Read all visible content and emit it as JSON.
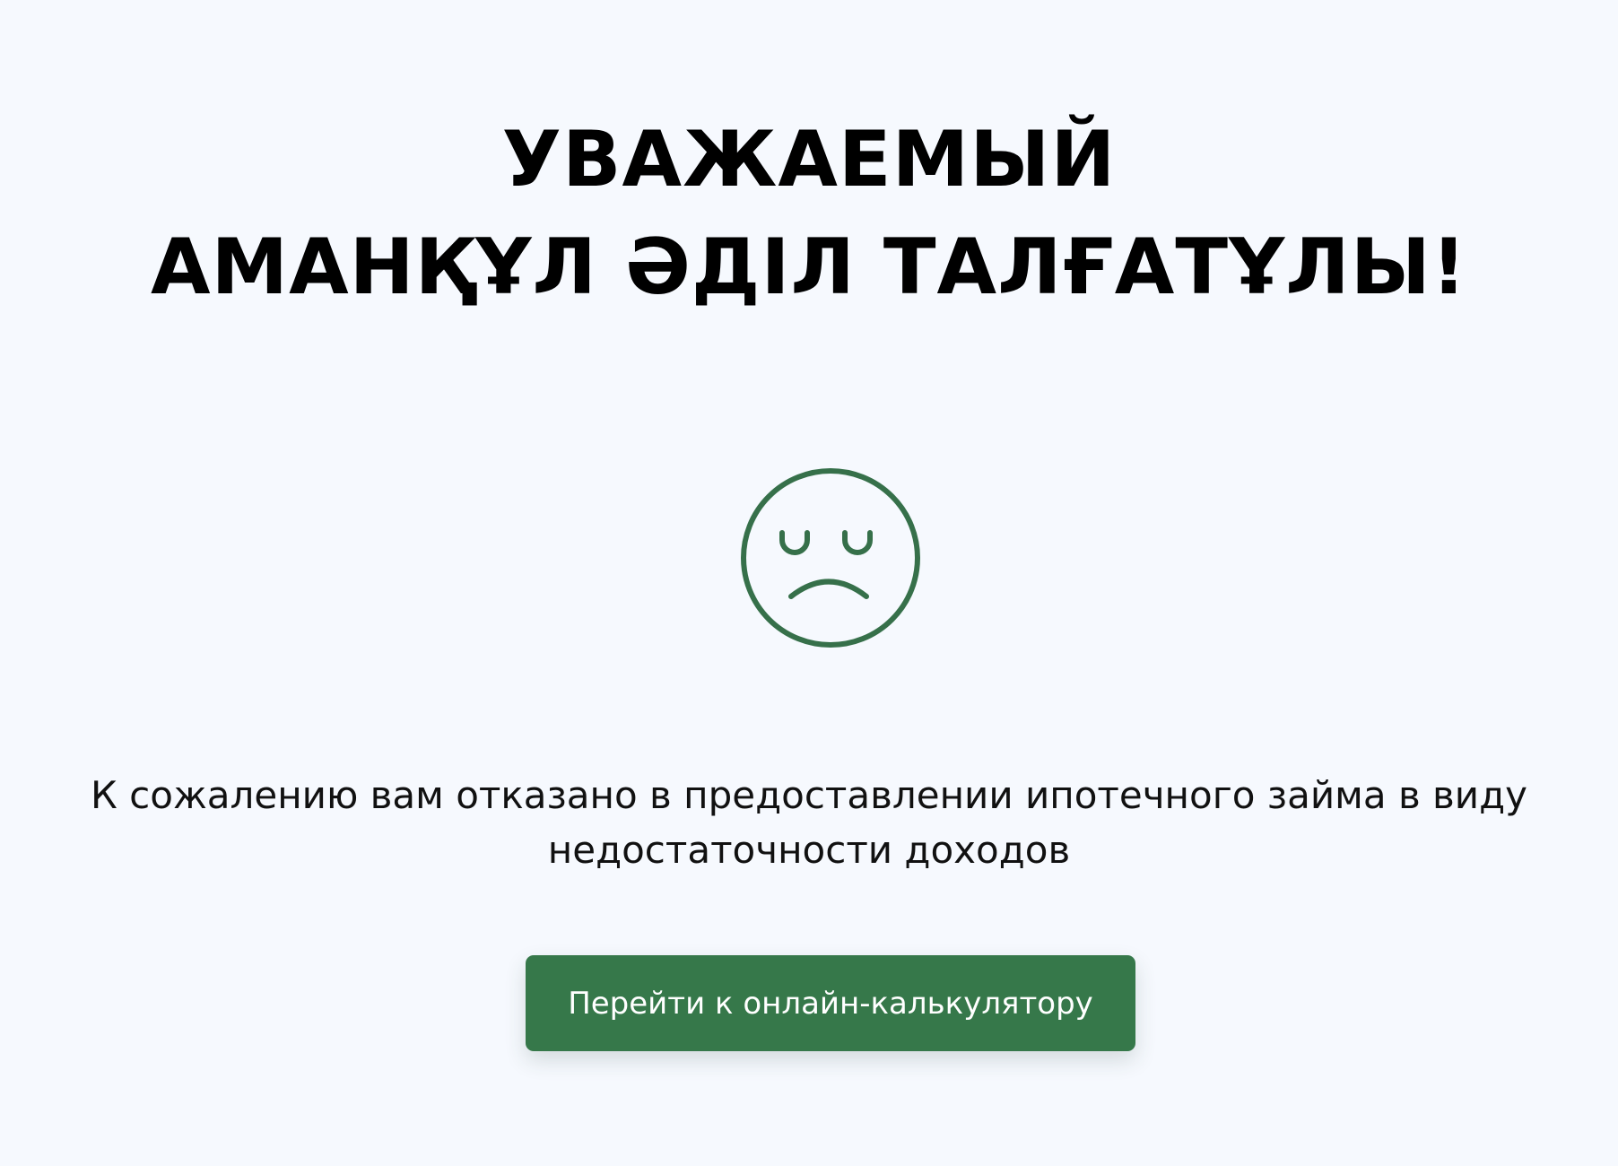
{
  "greeting": {
    "line1": "УВАЖАЕМЫЙ",
    "line2": "АМАНҚҰЛ ӘДІЛ ТАЛҒАТҰЛЫ!"
  },
  "icon": {
    "name": "sad-face-icon",
    "color": "#36704a"
  },
  "message": "К сожалению вам отказано в предоставлении ипотечного займа в виду недостаточности доходов",
  "cta_button": {
    "label": "Перейти к онлайн-калькулятору",
    "color": "#36784a"
  },
  "colors": {
    "background": "#f6f9fe",
    "text": "#000000",
    "accent": "#36784a"
  }
}
